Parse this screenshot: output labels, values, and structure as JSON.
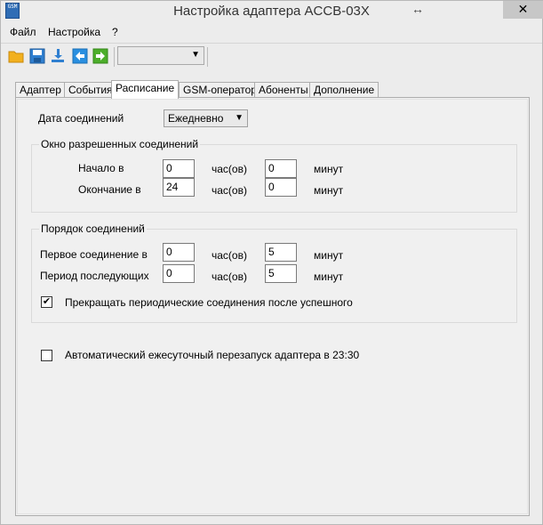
{
  "window": {
    "title": "Настройка адаптера ACCB-03X",
    "icon_text": "GSM",
    "close_glyph": "✕",
    "resize_glyph": "↔"
  },
  "menu": [
    "Файл",
    "Настройка",
    "?"
  ],
  "toolbar": {
    "buttons": [
      "open-folder-icon",
      "save-icon",
      "download-icon",
      "back-arrow-icon",
      "forward-arrow-icon"
    ],
    "combo_value": ""
  },
  "tabs": [
    "Адаптер",
    "События",
    "Расписание",
    "GSM-оператор",
    "Абоненты",
    "Дополнение"
  ],
  "active_tab": "Расписание",
  "schedule": {
    "connection_date_label": "Дата соединений",
    "connection_date_value": "Ежедневно",
    "window_group": {
      "title": "Окно разрешенных соединений",
      "start_label": "Начало в",
      "start_hours": "0",
      "start_minutes": "0",
      "end_label": "Окончание в",
      "end_hours": "24",
      "end_minutes": "0",
      "hours_unit": "час(ов)",
      "minutes_unit": "минут"
    },
    "order_group": {
      "title": "Порядок соединений",
      "first_label": "Первое соединение в",
      "first_hours": "0",
      "first_minutes": "5",
      "period_label": "Период последующих",
      "period_hours": "0",
      "period_minutes": "5",
      "hours_unit": "час(ов)",
      "minutes_unit": "минут",
      "stop_checkbox_label": "Прекращать периодические соединения после успешного",
      "stop_checked": true
    },
    "auto_restart_label": "Автоматический ежесуточный перезапуск адаптера в 23:30",
    "auto_restart_checked": false
  },
  "colors": {
    "icon_folder": "#f2b01e",
    "icon_save": "#2f7fd0",
    "icon_back": "#2a8fe0",
    "icon_forward": "#4cae2a"
  }
}
